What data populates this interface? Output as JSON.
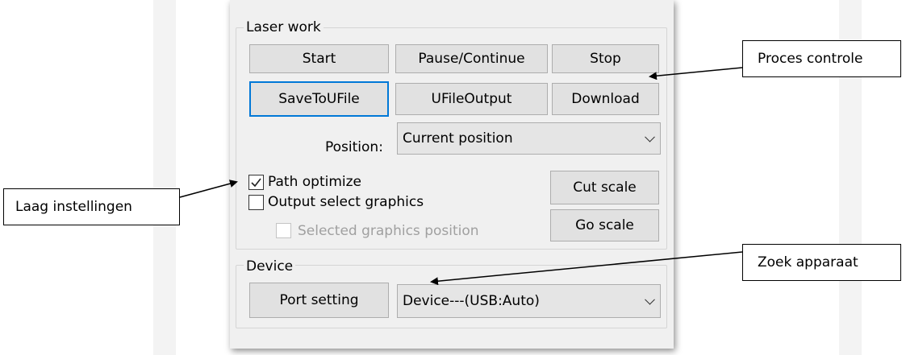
{
  "laser_work": {
    "title": "Laser work",
    "buttons": {
      "start": "Start",
      "pause_continue": "Pause/Continue",
      "stop": "Stop",
      "save_to_ufile": "SaveToUFile",
      "ufile_output": "UFileOutput",
      "download": "Download"
    },
    "position_label": "Position:",
    "position_value": "Current position",
    "options": {
      "path_optimize": {
        "label": "Path optimize",
        "checked": true
      },
      "output_select_graphics": {
        "label": "Output select graphics",
        "checked": false
      },
      "selected_graphics_position": {
        "label": "Selected graphics position",
        "checked": false,
        "enabled": false
      }
    },
    "cut_scale": "Cut scale",
    "go_scale": "Go scale"
  },
  "device": {
    "title": "Device",
    "port_setting": "Port setting",
    "device_value": "Device---(USB:Auto)"
  },
  "callouts": {
    "proces_controle": "Proces controle",
    "laag_instellingen": "Laag instellingen",
    "zoek_apparaat": "Zoek apparaat"
  },
  "colors": {
    "panel_bg": "#f0f0f0",
    "button_bg": "#e1e1e1",
    "default_button_border": "#0078d7"
  }
}
